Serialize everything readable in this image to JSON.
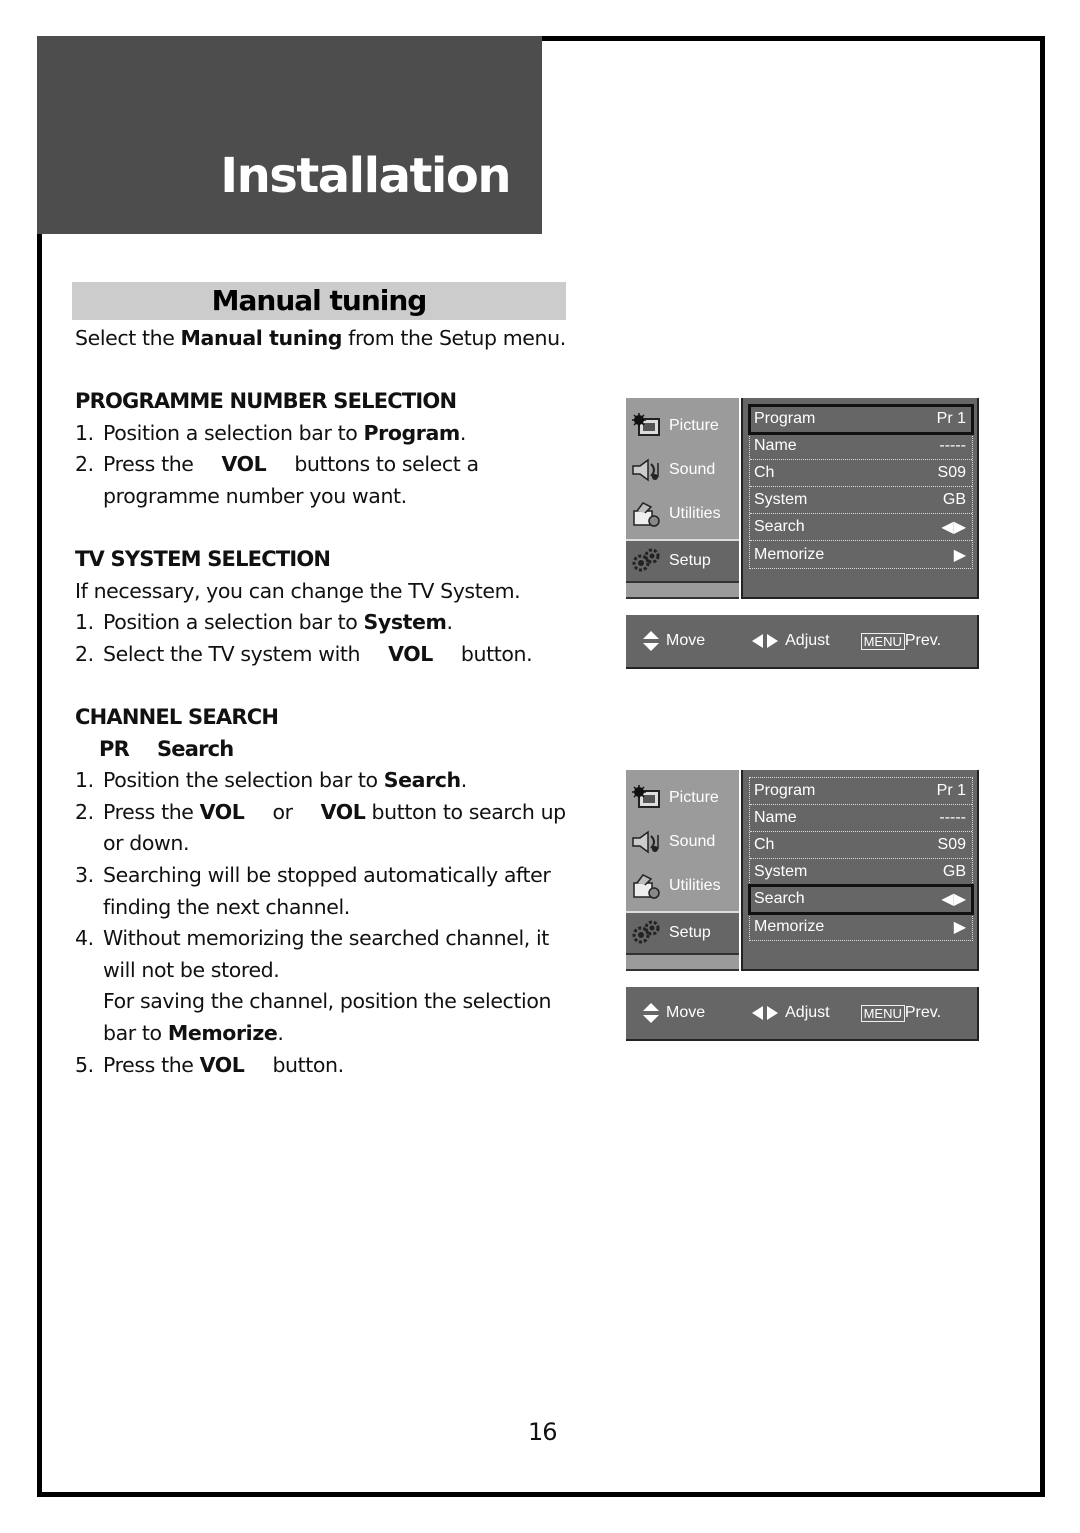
{
  "header": {
    "title": "Installation"
  },
  "section": {
    "title": "Manual tuning"
  },
  "intro": {
    "pre": "Select the ",
    "bold": "Manual tuning",
    "post": " from the Setup menu."
  },
  "programme_selection": {
    "heading": "PROGRAMME NUMBER SELECTION",
    "steps": [
      {
        "num": "1.",
        "pre": "Position a selection bar to ",
        "bold": "Program",
        "post": "."
      },
      {
        "num": "2.",
        "pre": "Press the",
        "bold": "VOL",
        "post": "buttons to select a",
        "cont": "programme number you want."
      }
    ]
  },
  "tv_system": {
    "heading": "TV SYSTEM SELECTION",
    "intro": "If necessary, you can change the TV System.",
    "steps": [
      {
        "num": "1.",
        "pre": "Position a selection bar to ",
        "bold": "System",
        "post": "."
      },
      {
        "num": "2.",
        "pre": "Select the TV system with",
        "bold": "VOL",
        "post": "button."
      }
    ]
  },
  "channel_search": {
    "heading": "CHANNEL SEARCH",
    "subheading": {
      "a": "PR",
      "b": "Search"
    },
    "steps": [
      {
        "num": "1.",
        "pre": "Position the selection bar to ",
        "bold": "Search",
        "post": "."
      },
      {
        "num": "2.",
        "pre": "Press the ",
        "bold": "VOL",
        "mid": "or",
        "bold2": "VOL",
        "post": " button to search up",
        "cont": "or down."
      },
      {
        "num": "3.",
        "text": "Searching will be stopped automatically after",
        "cont": "finding the next channel."
      },
      {
        "num": "4.",
        "text": "Without memorizing the searched channel, it",
        "cont": "will not be stored.",
        "cont2": "For saving the channel, position the selection",
        "cont3_pre": "bar to ",
        "cont3_bold": "Memorize",
        "cont3_post": "."
      },
      {
        "num": "5.",
        "pre": "Press the ",
        "bold": "VOL",
        "post": "button."
      }
    ]
  },
  "osd_menus": [
    {
      "sidebar": [
        {
          "label": "Picture",
          "icon": "picture-icon",
          "active": false
        },
        {
          "label": "Sound",
          "icon": "sound-icon",
          "active": false
        },
        {
          "label": "Utilities",
          "icon": "utilities-icon",
          "active": false
        },
        {
          "label": "Setup",
          "icon": "setup-icon",
          "active": true
        }
      ],
      "rows": [
        {
          "label": "Program",
          "value": "Pr 1",
          "selected": true
        },
        {
          "label": "Name",
          "value": "-----",
          "selected": false
        },
        {
          "label": "Ch",
          "value": "S09",
          "selected": false
        },
        {
          "label": "System",
          "value": "GB",
          "selected": false
        },
        {
          "label": "Search",
          "value": "◀▶",
          "selected": false
        },
        {
          "label": "Memorize",
          "value": "▶",
          "selected": false
        }
      ],
      "footer": {
        "move": "Move",
        "adjust": "Adjust",
        "menu_key": "MENU",
        "prev": "Prev."
      }
    },
    {
      "sidebar": [
        {
          "label": "Picture",
          "icon": "picture-icon",
          "active": false
        },
        {
          "label": "Sound",
          "icon": "sound-icon",
          "active": false
        },
        {
          "label": "Utilities",
          "icon": "utilities-icon",
          "active": false
        },
        {
          "label": "Setup",
          "icon": "setup-icon",
          "active": true
        }
      ],
      "rows": [
        {
          "label": "Program",
          "value": "Pr 1",
          "selected": false
        },
        {
          "label": "Name",
          "value": "-----",
          "selected": false
        },
        {
          "label": "Ch",
          "value": "S09",
          "selected": false
        },
        {
          "label": "System",
          "value": "GB",
          "selected": false
        },
        {
          "label": "Search",
          "value": "◀▶",
          "selected": true
        },
        {
          "label": "Memorize",
          "value": "▶",
          "selected": false
        }
      ],
      "footer": {
        "move": "Move",
        "adjust": "Adjust",
        "menu_key": "MENU",
        "prev": "Prev."
      }
    }
  ],
  "page_number": "16"
}
